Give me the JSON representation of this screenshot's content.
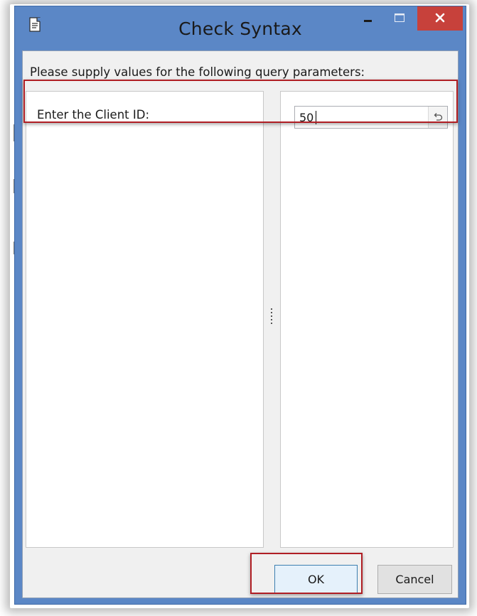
{
  "window": {
    "title": "Check Syntax",
    "icon": "document-icon",
    "controls": {
      "minimize_icon": "minimize-icon",
      "maximize_icon": "maximize-icon",
      "close_icon": "close-icon"
    }
  },
  "dialog": {
    "prompt": "Please supply values for the following query parameters:",
    "parameters": [
      {
        "label": "Enter the Client ID:",
        "value": "50",
        "reset_icon": "undo-icon"
      }
    ]
  },
  "buttons": {
    "ok_label": "OK",
    "cancel_label": "Cancel"
  },
  "colors": {
    "titlebar": "#5b87c6",
    "close_button": "#c7413b",
    "highlight_outline": "#b01e24",
    "ok_button_border": "#3c7fb1"
  }
}
